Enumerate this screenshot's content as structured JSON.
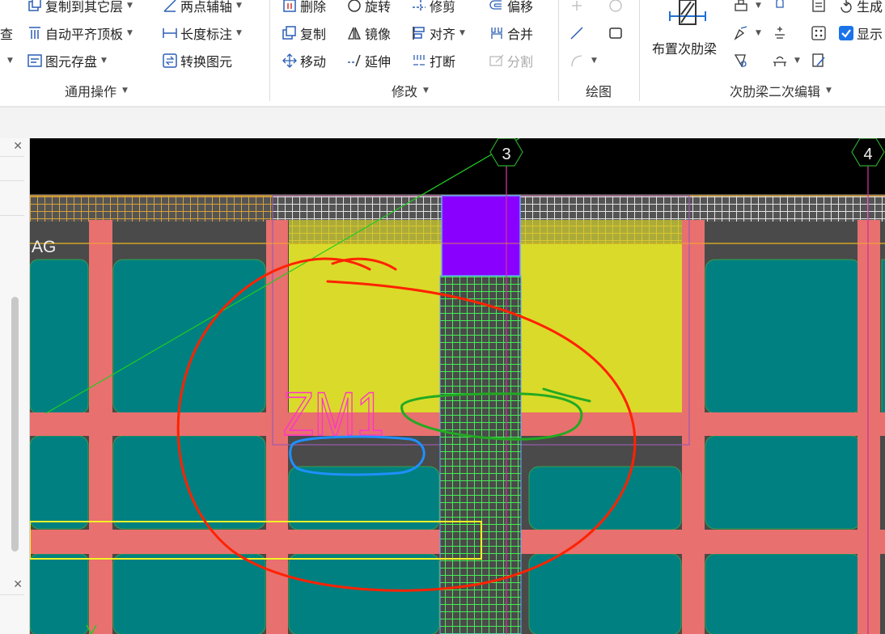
{
  "ribbon": {
    "general_ops": {
      "group_label": "通用操作",
      "partial_label": "查",
      "copy_to_other_layer": "复制到其它层",
      "two_point_axis": "两点辅轴",
      "auto_flush_top": "自动平齐顶板",
      "length_dimension": "长度标注",
      "element_archive": "图元存盘",
      "convert_element": "转换图元"
    },
    "modify": {
      "group_label": "修改",
      "delete": "删除",
      "rotate": "旋转",
      "trim": "修剪",
      "offset": "偏移",
      "copy": "复制",
      "mirror": "镜像",
      "align": "对齐",
      "merge": "合并",
      "move": "移动",
      "extend": "延伸",
      "break": "打断",
      "split": "分割"
    },
    "draw": {
      "group_label": "绘图"
    },
    "secondary_rib": {
      "group_label": "次肋梁二次编辑",
      "place_secondary_rib": "布置次肋梁",
      "generate_partial": "生成",
      "show_partial": "显示",
      "show_checked": true
    }
  },
  "canvas": {
    "axis_labels": [
      "3",
      "4"
    ],
    "element_label": "ZM1",
    "layer_label": "AG"
  },
  "colors": {
    "canvas_background": "#000000",
    "slab_teal": "#008080",
    "rib_salmon": "#e8706f",
    "column_yellow": "#dada2a",
    "cap_purple": "#8a00ff",
    "mesh_green": "#44ee55",
    "axis_magenta": "#cc3399",
    "annotation_red": "#ff2200",
    "annotation_green": "#22aa22",
    "annotation_blue": "#1e90ff",
    "label_pink": "#ff33cc",
    "checkbox_blue": "#1a73e8"
  }
}
